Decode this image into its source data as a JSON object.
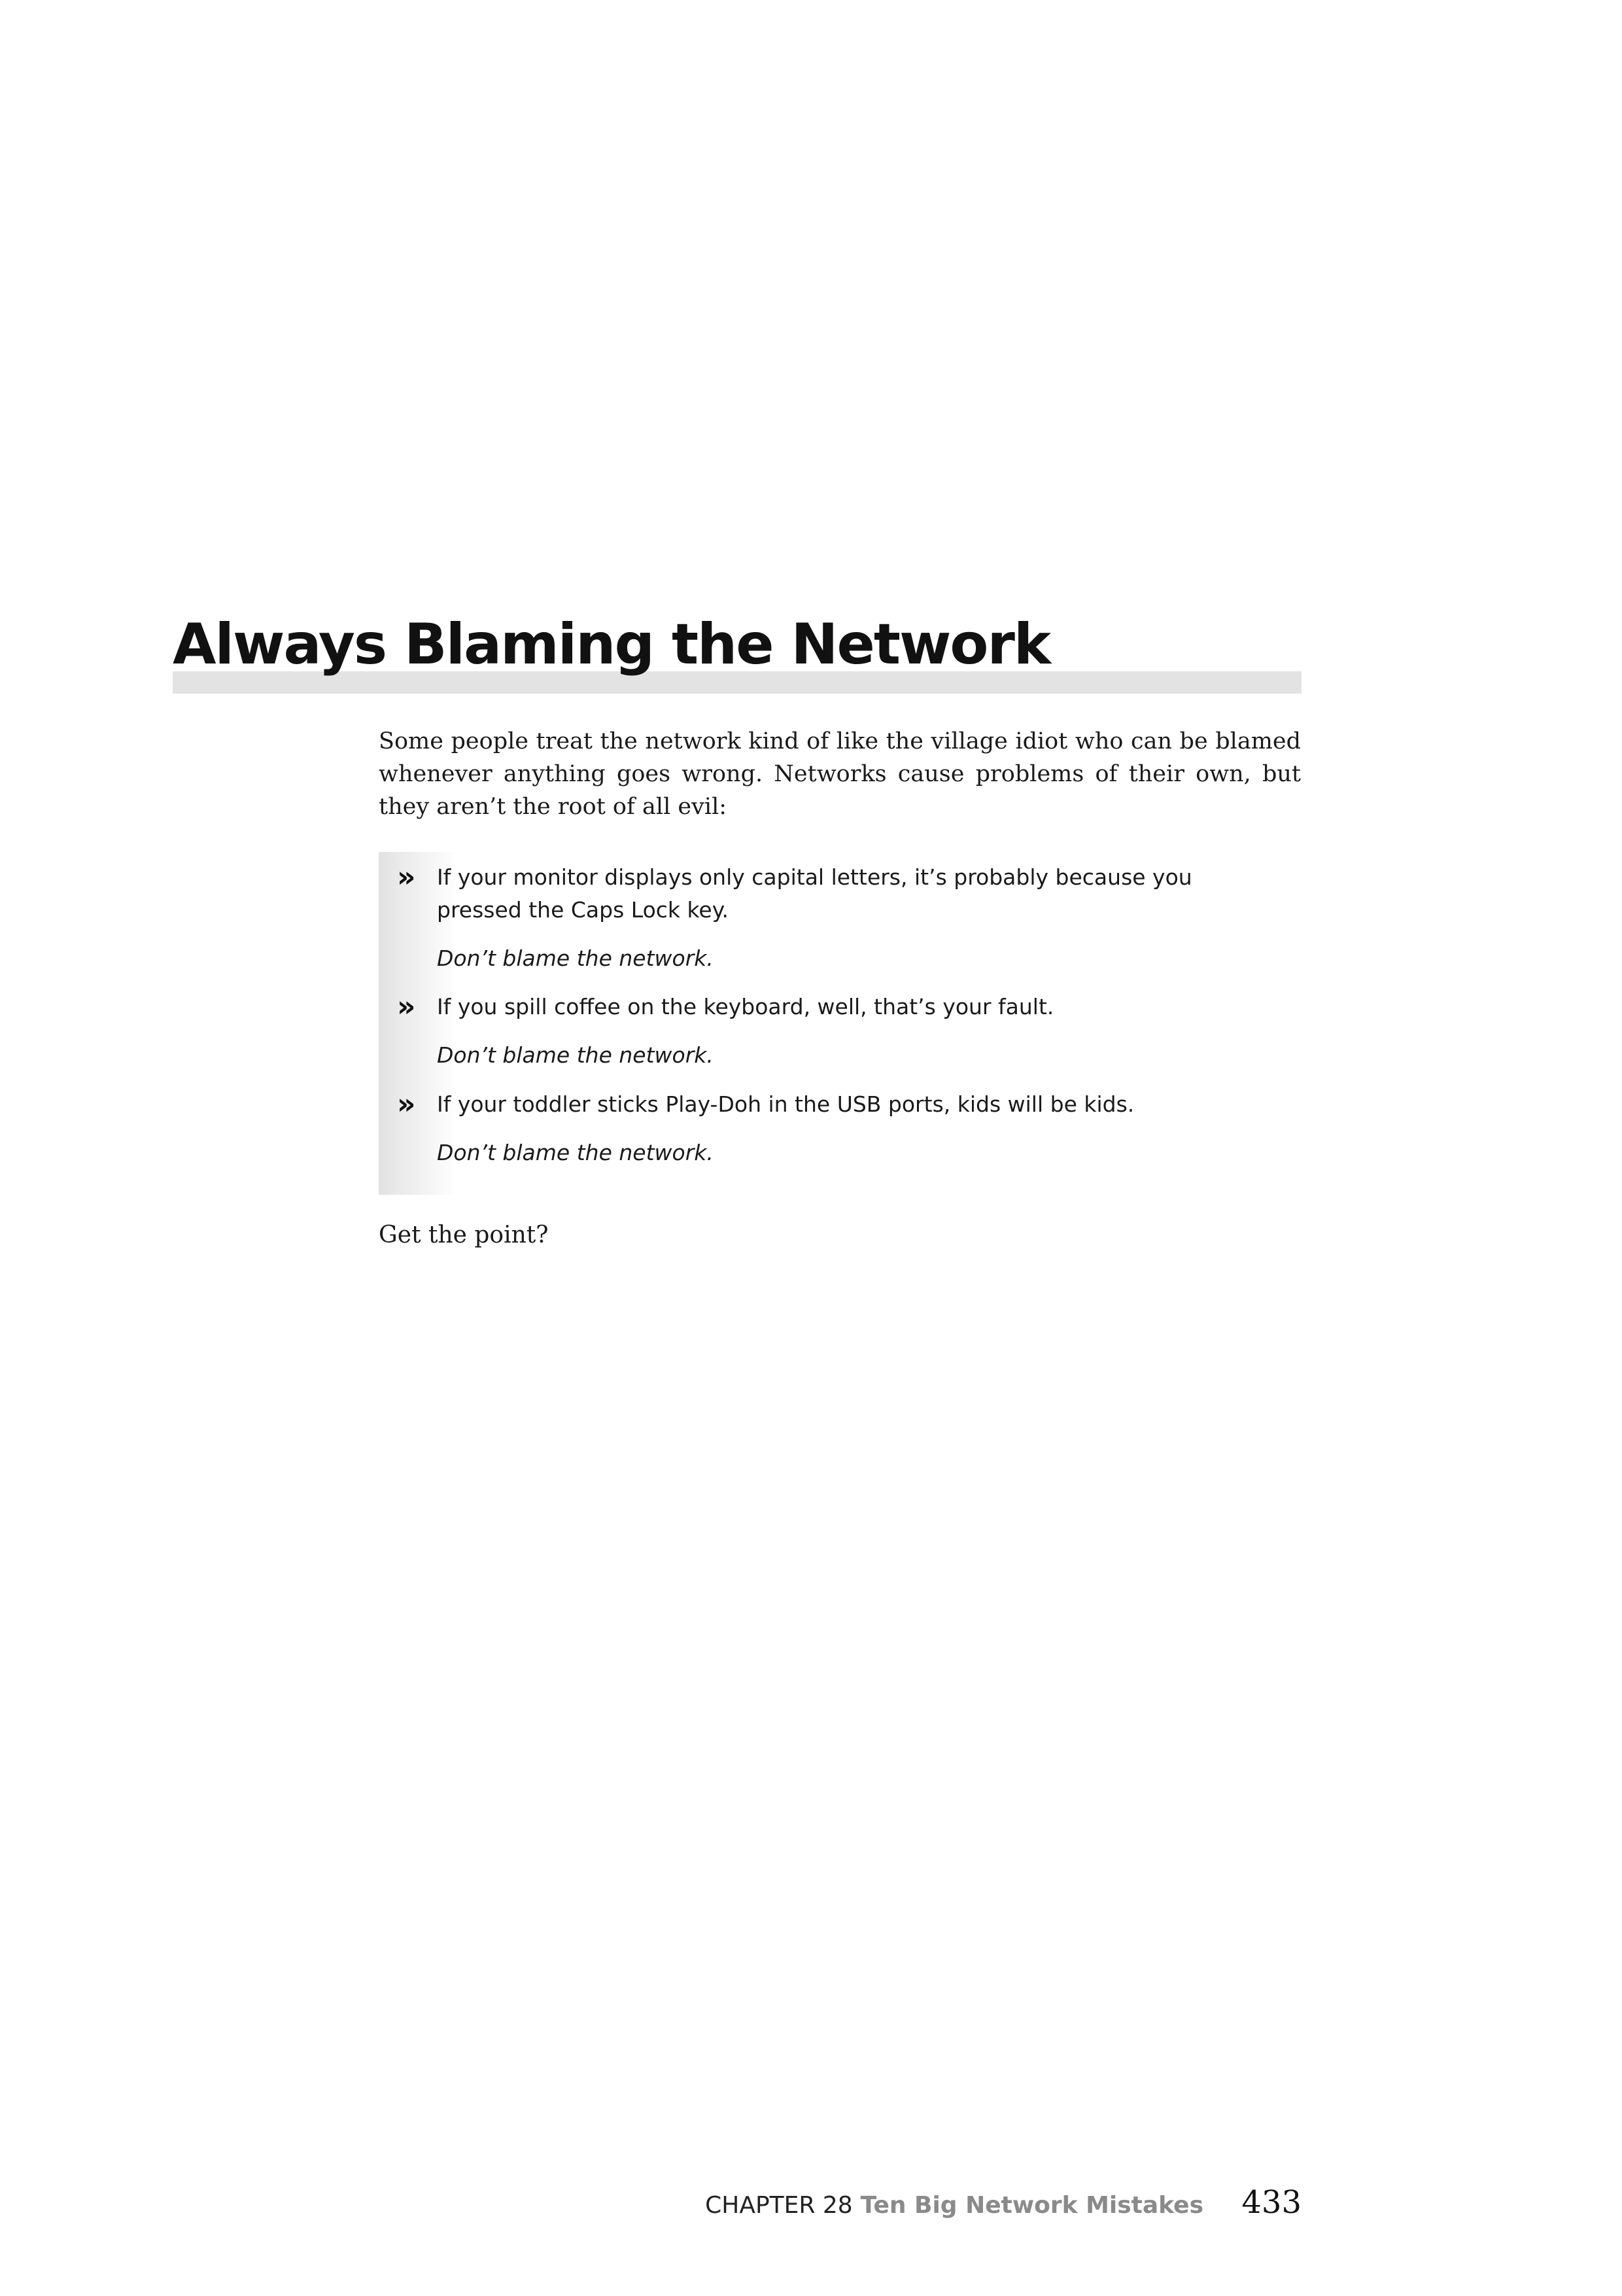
{
  "section": {
    "heading": "Always Blaming the Network",
    "intro": "Some people treat the network kind of like the village idiot who can be blamed whenever anything goes wrong. Networks cause problems of their own, but they aren’t the root of all evil:",
    "bullets": [
      {
        "icon": "chevron-double-right-icon",
        "text": "If your monitor displays only capital letters, it’s probably because you pressed the Caps Lock key.",
        "note": "Don’t blame the network."
      },
      {
        "icon": "chevron-double-right-icon",
        "text": "If you spill coffee on the keyboard, well, that’s your fault.",
        "note": "Don’t blame the network."
      },
      {
        "icon": "chevron-double-right-icon",
        "text": "If your toddler sticks Play-Doh in the USB ports, kids will be kids.",
        "note": "Don’t blame the network."
      }
    ],
    "outro": "Get the point?"
  },
  "footer": {
    "chapter_label": "CHAPTER 28",
    "chapter_title": "Ten Big Network Mistakes",
    "page_number": "433"
  }
}
